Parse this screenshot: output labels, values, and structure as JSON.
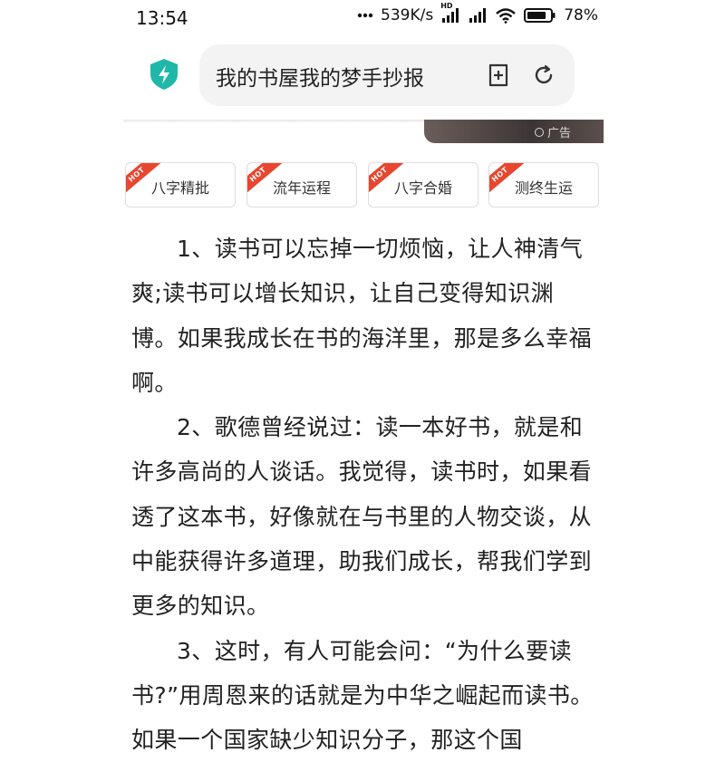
{
  "status_bar": {
    "time": "13:54",
    "network_speed": "539K/s",
    "network_badge": "HD",
    "battery_percent": "78%"
  },
  "search": {
    "query": "我的书屋我的梦手抄报",
    "icons": [
      "shield-icon",
      "add-bookmark-icon",
      "refresh-icon"
    ]
  },
  "ad": {
    "label": "广告"
  },
  "tags": [
    {
      "label": "八字精批",
      "badge": "HOT"
    },
    {
      "label": "流年运程",
      "badge": "HOT"
    },
    {
      "label": "八字合婚",
      "badge": "HOT"
    },
    {
      "label": "测终生运",
      "badge": "HOT"
    }
  ],
  "article": {
    "paragraphs": [
      "1、读书可以忘掉一切烦恼，让人神清气爽;读书可以增长知识，让自己变得知识渊博。如果我成长在书的海洋里，那是多么幸福啊。",
      "2、歌德曾经说过：读一本好书，就是和许多高尚的人谈话。我觉得，读书时，如果看透了这本书，好像就在与书里的人物交谈，从中能获得许多道理，助我们成长，帮我们学到更多的知识。",
      "3、这时，有人可能会问：“为什么要读书?”用周恩来的话就是为中华之崛起而读书。如果一个国家缺少知识分子，那这个国"
    ]
  },
  "colors": {
    "accent_teal": "#1fb8a8",
    "hot_badge": "#e8462f",
    "search_bg": "#f3f3f3"
  }
}
